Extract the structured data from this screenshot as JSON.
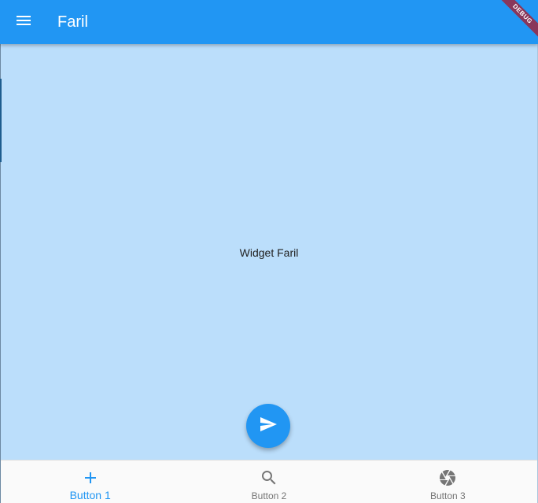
{
  "app_bar": {
    "title": "Faril",
    "menu_icon": "menu-icon"
  },
  "debug_banner": {
    "label": "DEBUG"
  },
  "body": {
    "text": "Widget Faril"
  },
  "fab": {
    "icon": "send-icon"
  },
  "bottom_nav": {
    "items": [
      {
        "label": "Button 1",
        "icon": "add-icon",
        "active": true
      },
      {
        "label": "Button 2",
        "icon": "search-icon",
        "active": false
      },
      {
        "label": "Button 3",
        "icon": "camera-shutter-icon",
        "active": false
      }
    ]
  },
  "colors": {
    "primary": "#2196f3",
    "body_background": "#bbdefb",
    "nav_background": "#fafafa",
    "inactive": "#757575",
    "debug_ribbon": "#a41f35"
  }
}
